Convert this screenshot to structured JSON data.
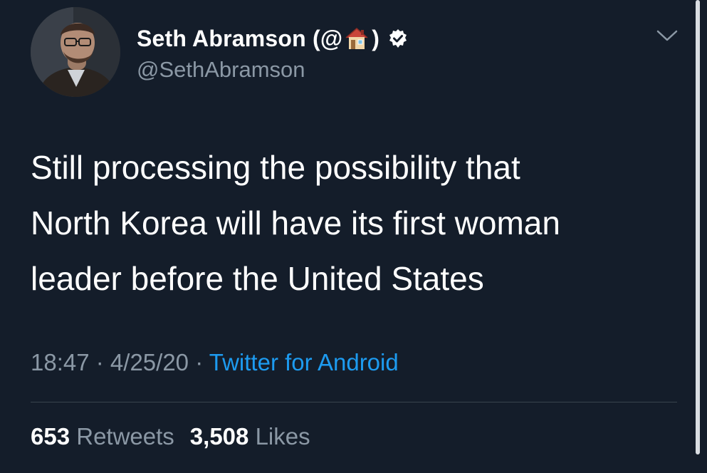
{
  "author": {
    "display_name_prefix": "Seth Abramson (@",
    "display_name_suffix": ")",
    "handle": "@SethAbramson",
    "verified": true
  },
  "tweet": {
    "lines": [
      "Still processing the possibility that",
      "North Korea will have its first woman",
      "leader before the United States"
    ],
    "time": "18:47",
    "separator": " · ",
    "date": "4/25/20",
    "source": "Twitter for Android"
  },
  "stats": {
    "retweets_count": "653",
    "retweets_label": "Retweets",
    "likes_count": "3,508",
    "likes_label": "Likes"
  },
  "icons": {
    "name_emoji": "house-icon",
    "badge": "verified-badge-icon",
    "menu": "chevron-down-icon"
  },
  "colors": {
    "background": "#141d2a",
    "secondary_text": "#8b98a5",
    "link": "#1d9bf0",
    "divider": "#38444d"
  }
}
